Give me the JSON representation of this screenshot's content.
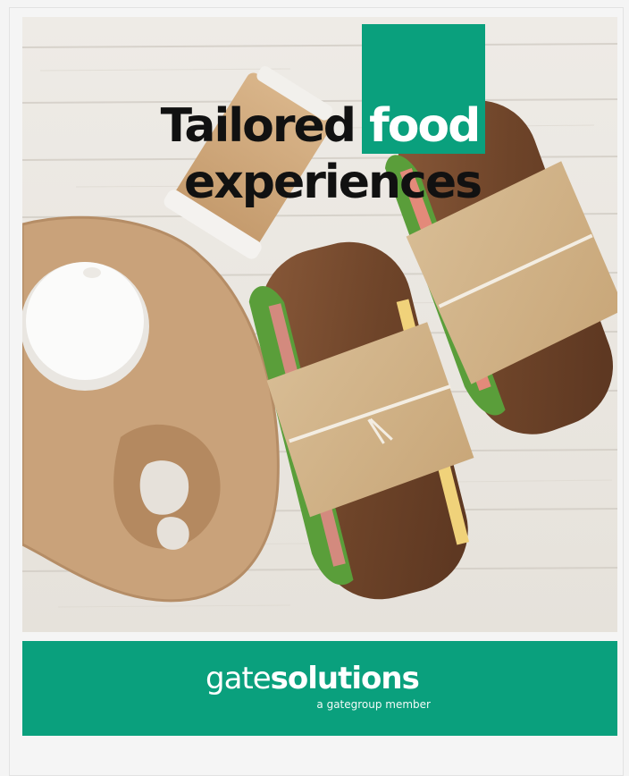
{
  "headline": {
    "line1_plain": "Tailored ",
    "line1_accent": "food",
    "line2": "experiences"
  },
  "brand": {
    "name_light": "gate",
    "name_bold": "solutions",
    "tagline": "a gategroup member"
  },
  "colors": {
    "brand_green": "#0aa07d",
    "headline_text": "#111111",
    "background": "#f5f5f5"
  }
}
